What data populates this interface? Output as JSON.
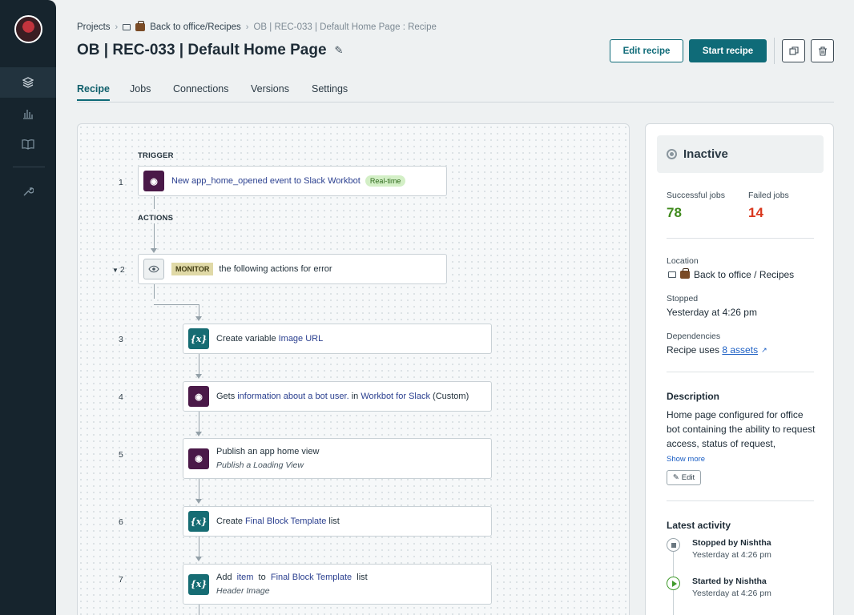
{
  "sidebar": {
    "items": [
      {
        "name": "recipes-icon",
        "active": true
      },
      {
        "name": "dashboard-icon",
        "active": false
      },
      {
        "name": "docs-icon",
        "active": false
      },
      {
        "name": "tools-icon",
        "active": false
      }
    ]
  },
  "breadcrumb": {
    "projects": "Projects",
    "folder": "Back to office/Recipes",
    "current": "OB | REC-033 | Default Home Page : Recipe"
  },
  "header": {
    "title": "OB | REC-033 | Default Home Page",
    "edit_label": "Edit recipe",
    "start_label": "Start recipe"
  },
  "tabs": [
    {
      "label": "Recipe",
      "active": true
    },
    {
      "label": "Jobs",
      "active": false
    },
    {
      "label": "Connections",
      "active": false
    },
    {
      "label": "Versions",
      "active": false
    },
    {
      "label": "Settings",
      "active": false
    }
  ],
  "recipe": {
    "trigger_label": "TRIGGER",
    "actions_label": "ACTIONS",
    "steps": {
      "s1": {
        "num": "1",
        "text": "New app_home_opened event to Slack Workbot",
        "badge": "Real-time"
      },
      "s2": {
        "num": "2",
        "badge": "MONITOR",
        "text": "the following actions for error"
      },
      "s3": {
        "num": "3",
        "pre": "Create variable ",
        "hl": "Image URL"
      },
      "s4": {
        "num": "4",
        "pre": "Gets ",
        "hl1": "information about a bot user.",
        "mid": " in ",
        "hl2": "Workbot for Slack",
        "post": " (Custom)"
      },
      "s5": {
        "num": "5",
        "text": "Publish an app home view",
        "sub": "Publish a Loading View"
      },
      "s6": {
        "num": "6",
        "pre": "Create ",
        "hl": "Final Block Template",
        "post": " list"
      },
      "s7": {
        "num": "7",
        "pre": "Add ",
        "hl1": "item",
        "mid": " to ",
        "hl2": "Final Block Template",
        "post": " list",
        "sub": "Header Image"
      }
    }
  },
  "panel": {
    "status": "Inactive",
    "successful_label": "Successful jobs",
    "successful_value": "78",
    "failed_label": "Failed jobs",
    "failed_value": "14",
    "location_label": "Location",
    "location_value": "Back to office / Recipes",
    "stopped_label": "Stopped",
    "stopped_value": "Yesterday at 4:26 pm",
    "dependencies_label": "Dependencies",
    "dependencies_pre": "Recipe uses ",
    "dependencies_link": "8 assets",
    "description_label": "Description",
    "description": "Home page configured for office bot containing the ability to request access, status of request,",
    "show_more": "Show more",
    "edit_label": "Edit",
    "activity_label": "Latest activity",
    "activity": [
      {
        "title": "Stopped by Nishtha",
        "time": "Yesterday at 4:26 pm"
      },
      {
        "title": "Started by Nishtha",
        "time": "Yesterday at 4:26 pm"
      }
    ]
  },
  "colors": {
    "primary": "#0f6b78",
    "success": "#3f8a1c",
    "danger": "#d9381e",
    "sidebar": "#16242d"
  }
}
